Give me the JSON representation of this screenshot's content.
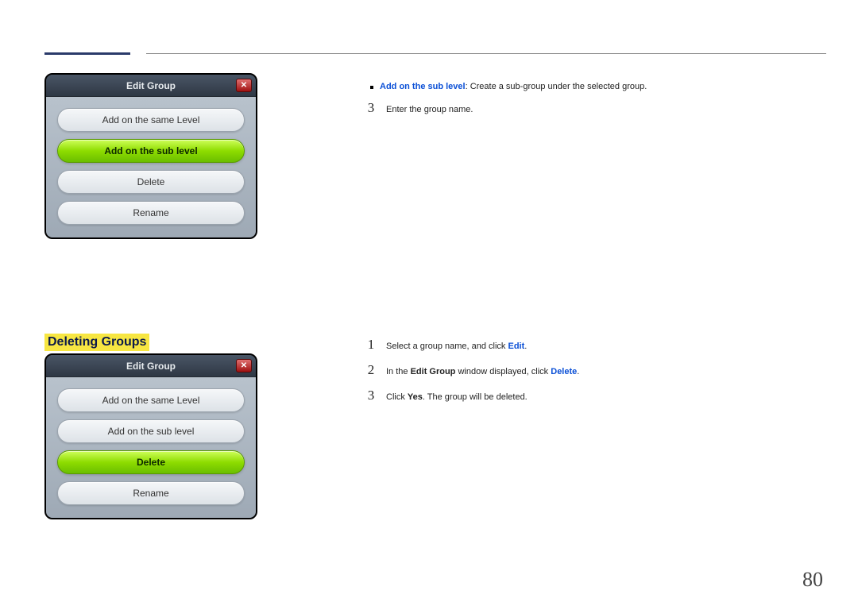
{
  "header": {},
  "dialog1": {
    "title": "Edit Group",
    "close": "✕",
    "btn_same": "Add on the same Level",
    "btn_sub": "Add on the sub level",
    "btn_delete": "Delete",
    "btn_rename": "Rename"
  },
  "section2": {
    "title": "Deleting Groups"
  },
  "dialog2": {
    "title": "Edit Group",
    "close": "✕",
    "btn_same": "Add on the same Level",
    "btn_sub": "Add on the sub level",
    "btn_delete": "Delete",
    "btn_rename": "Rename"
  },
  "right": {
    "bullet_bold": "Add on the sub level",
    "bullet_rest": ": Create a sub-group under the selected group.",
    "step3a": "Enter the group name.",
    "d_step1_a": "Select a group name, and click ",
    "d_step1_b": "Edit",
    "d_step1_c": ".",
    "d_step2_a": "In the ",
    "d_step2_b": "Edit Group",
    "d_step2_c": " window displayed, click ",
    "d_step2_d": "Delete",
    "d_step2_e": ".",
    "d_step3_a": "Click ",
    "d_step3_b": "Yes",
    "d_step3_c": ". The group will be deleted.",
    "n1": "1",
    "n2": "2",
    "n3": "3",
    "n3b": "3"
  },
  "page_number": "80"
}
